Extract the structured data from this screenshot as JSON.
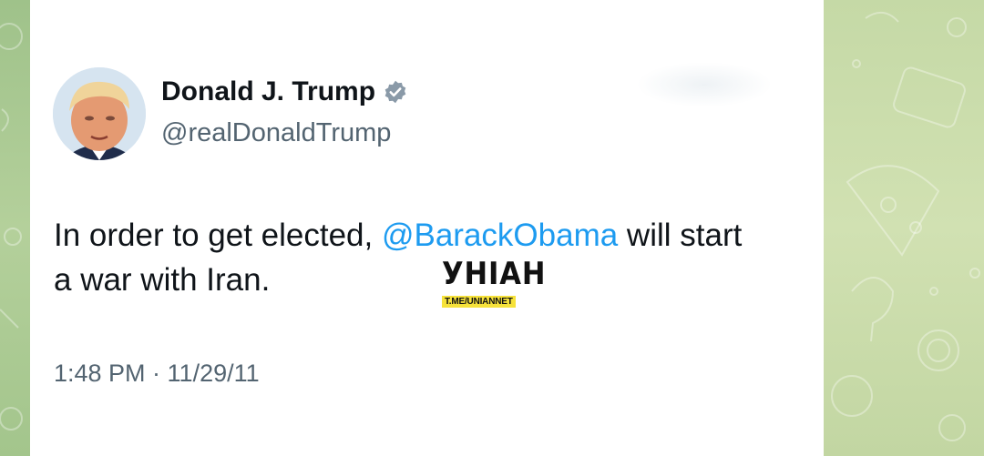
{
  "author": {
    "display_name": "Donald J. Trump",
    "handle": "@realDonaldTrump",
    "verified_icon": "verified-badge-icon"
  },
  "tweet": {
    "text_before": "In order to get elected, ",
    "mention": "@BarackObama",
    "text_after": " will start a war with Iran.",
    "timestamp": "1:48 PM · 11/29/11"
  },
  "watermark": {
    "logo": "УНІАН",
    "tag": "T.ME/UNIANNET"
  },
  "colors": {
    "card_background": "#ffffff",
    "name_text": "#0f1419",
    "secondary_text": "#536471",
    "mention": "#1d9bf0",
    "verified_badge": "#8a9aa8",
    "watermark_tag": "#f6e23a",
    "backdrop_green": "#c2d6a2"
  }
}
